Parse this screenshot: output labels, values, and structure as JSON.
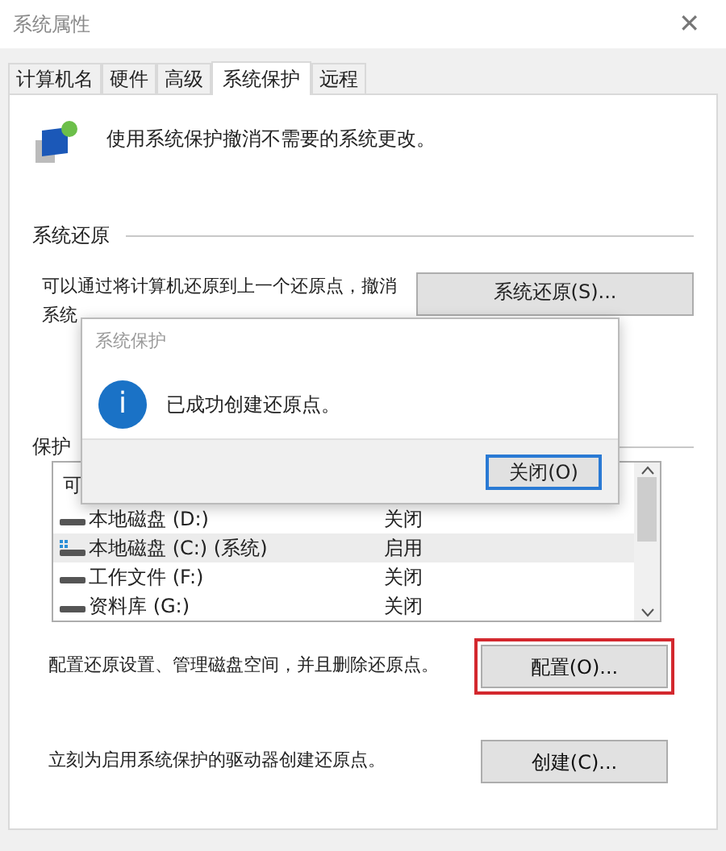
{
  "window": {
    "title": "系统属性",
    "close": "✕"
  },
  "tabs": [
    {
      "label": "计算机名",
      "selected": false
    },
    {
      "label": "硬件",
      "selected": false
    },
    {
      "label": "高级",
      "selected": false
    },
    {
      "label": "系统保护",
      "selected": true
    },
    {
      "label": "远程",
      "selected": false
    }
  ],
  "intro": "使用系统保护撤消不需要的系统更改。",
  "restore_section": {
    "heading": "系统还原",
    "text_line_1": "可以通过将计算机还原到上一个还原点，撤消",
    "text_line_2": "系统",
    "button": "系统还原(S)..."
  },
  "protection_section": {
    "heading": "保护",
    "list_header": "可",
    "drives": [
      {
        "name": "本地磁盘 (D:)",
        "status": "关闭",
        "system": false,
        "selected": false
      },
      {
        "name": "本地磁盘 (C:) (系统)",
        "status": "启用",
        "system": true,
        "selected": true
      },
      {
        "name": "工作文件 (F:)",
        "status": "关闭",
        "system": false,
        "selected": false
      },
      {
        "name": "资料库 (G:)",
        "status": "关闭",
        "system": false,
        "selected": false
      }
    ]
  },
  "configure": {
    "text": "配置还原设置、管理磁盘空间，并且删除还原点。",
    "button": "配置(O)...",
    "highlighted": true
  },
  "create": {
    "text": "立刻为启用系统保护的驱动器创建还原点。",
    "button": "创建(C)...",
    "highlighted": false
  },
  "dialog": {
    "title": "系统保护",
    "icon_letter": "i",
    "message": "已成功创建还原点。",
    "button": "关闭(O)"
  }
}
